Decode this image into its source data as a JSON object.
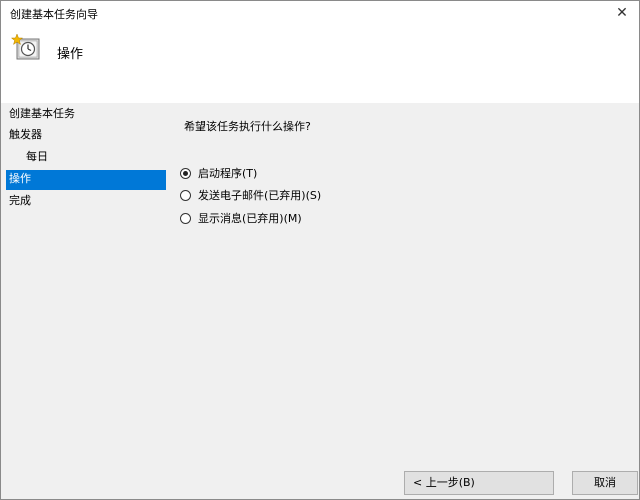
{
  "window": {
    "title": "创建基本任务向导",
    "close_symbol": "✕"
  },
  "header": {
    "icon": "scheduled-task-clock-icon",
    "title": "操作"
  },
  "nav": {
    "items": [
      {
        "label": "创建基本任务",
        "selected": false
      },
      {
        "label": "触发器",
        "selected": false
      },
      {
        "label": "每日",
        "selected": false
      },
      {
        "label": "操作",
        "selected": true
      },
      {
        "label": "完成",
        "selected": false
      }
    ]
  },
  "content": {
    "question": "希望该任务执行什么操作?",
    "options": [
      {
        "label": "启动程序(T)",
        "checked": true
      },
      {
        "label": "发送电子邮件(已弃用)(S)",
        "checked": false
      },
      {
        "label": "显示消息(已弃用)(M)",
        "checked": false
      }
    ]
  },
  "footer": {
    "back_label": "< 上一步(B)",
    "cancel_label": "取消"
  },
  "colors": {
    "selection": "#0078d7",
    "window_bg": "#f0f0f0",
    "header_bg": "#ffffff"
  }
}
